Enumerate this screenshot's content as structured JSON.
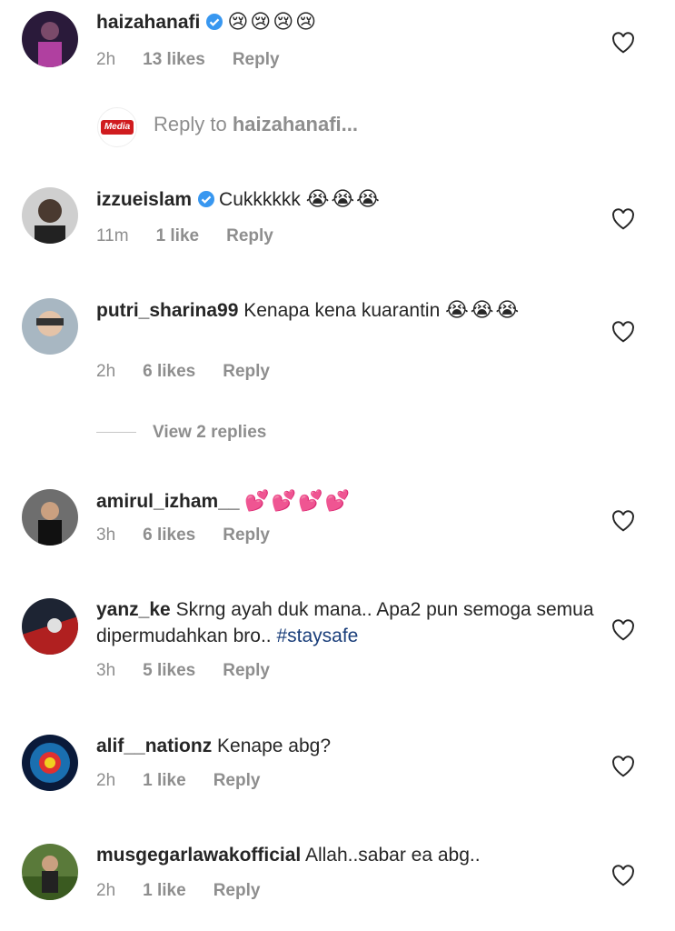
{
  "comments": [
    {
      "username": "haizahanafi",
      "verified": true,
      "text": "",
      "emoji": "😢😢😢😢",
      "time": "2h",
      "likes": "13 likes",
      "reply": "Reply"
    },
    {
      "username": "izzueislam",
      "verified": true,
      "text": "Cukkkkkk",
      "emoji": "😭😭😭",
      "time": "11m",
      "likes": "1 like",
      "reply": "Reply"
    },
    {
      "username": "putri_sharina99",
      "verified": false,
      "text": "Kenapa kena kuarantin",
      "emoji": "😭😭😭",
      "time": "2h",
      "likes": "6 likes",
      "reply": "Reply"
    },
    {
      "username": "amirul_izham__",
      "verified": false,
      "text": "",
      "emoji": "💕💕💕💕",
      "time": "3h",
      "likes": "6 likes",
      "reply": "Reply"
    },
    {
      "username": "yanz_ke",
      "verified": false,
      "text": "Skrng ayah duk mana.. Apa2 pun semoga semua dipermudahkan bro..",
      "hashtag": "#staysafe",
      "time": "3h",
      "likes": "5 likes",
      "reply": "Reply"
    },
    {
      "username": "alif__nationz",
      "verified": false,
      "text": "Kenape abg?",
      "time": "2h",
      "likes": "1 like",
      "reply": "Reply"
    },
    {
      "username": "musgegarlawakofficial",
      "verified": false,
      "text": "Allah..sabar ea abg..",
      "time": "2h",
      "likes": "1 like",
      "reply": "Reply"
    }
  ],
  "reply_box": {
    "prefix": "Reply to ",
    "target": "haizahanafi...",
    "logo_text": "Media"
  },
  "view_replies": "View 2 replies",
  "icons": {
    "like": "heart-outline-icon",
    "verified": "verified-badge-icon"
  },
  "colors": {
    "verified": "#3897f0",
    "hashtag": "#1a3e7a",
    "meta": "#8e8e8e"
  }
}
